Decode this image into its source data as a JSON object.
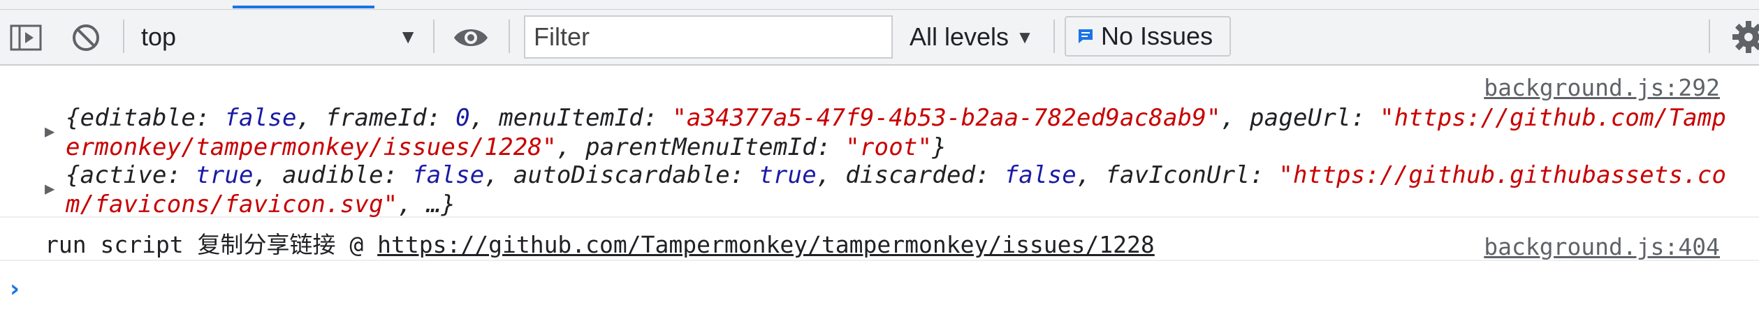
{
  "toolbar": {
    "context": "top",
    "filter_placeholder": "Filter",
    "levels": "All levels",
    "issues": "No Issues"
  },
  "console": {
    "messages": [
      {
        "source": "background.js:292",
        "parts": [
          {
            "t": "p",
            "v": "{"
          },
          {
            "t": "k",
            "v": "editable"
          },
          {
            "t": "p",
            "v": ": "
          },
          {
            "t": "kw",
            "v": "false"
          },
          {
            "t": "p",
            "v": ", "
          },
          {
            "t": "k",
            "v": "frameId"
          },
          {
            "t": "p",
            "v": ": "
          },
          {
            "t": "num",
            "v": "0"
          },
          {
            "t": "p",
            "v": ", "
          },
          {
            "t": "k",
            "v": "menuItemId"
          },
          {
            "t": "p",
            "v": ": "
          },
          {
            "t": "str",
            "v": "\"a34377a5-47f9-4b53-b2aa-782ed9ac8ab9\""
          },
          {
            "t": "p",
            "v": ", "
          },
          {
            "t": "k",
            "v": "pageUrl"
          },
          {
            "t": "p",
            "v": ": "
          },
          {
            "t": "str",
            "v": "\"https://github.com/Tampermonkey/tampermonkey/issues/1228\""
          },
          {
            "t": "p",
            "v": ", "
          },
          {
            "t": "k",
            "v": "parentMenuItemId"
          },
          {
            "t": "p",
            "v": ": "
          },
          {
            "t": "str",
            "v": "\"root\""
          },
          {
            "t": "p",
            "v": "}"
          }
        ]
      },
      {
        "source": "",
        "parts": [
          {
            "t": "p",
            "v": "{"
          },
          {
            "t": "k",
            "v": "active"
          },
          {
            "t": "p",
            "v": ": "
          },
          {
            "t": "kw",
            "v": "true"
          },
          {
            "t": "p",
            "v": ", "
          },
          {
            "t": "k",
            "v": "audible"
          },
          {
            "t": "p",
            "v": ": "
          },
          {
            "t": "kw",
            "v": "false"
          },
          {
            "t": "p",
            "v": ", "
          },
          {
            "t": "k",
            "v": "autoDiscardable"
          },
          {
            "t": "p",
            "v": ": "
          },
          {
            "t": "kw",
            "v": "true"
          },
          {
            "t": "p",
            "v": ", "
          },
          {
            "t": "k",
            "v": "discarded"
          },
          {
            "t": "p",
            "v": ": "
          },
          {
            "t": "kw",
            "v": "false"
          },
          {
            "t": "p",
            "v": ", "
          },
          {
            "t": "k",
            "v": "favIconUrl"
          },
          {
            "t": "p",
            "v": ": "
          },
          {
            "t": "str",
            "v": "\"https://github.githubassets.com/favicons/favicon.svg\""
          },
          {
            "t": "p",
            "v": ", …}"
          }
        ]
      }
    ],
    "log": {
      "text": "run script 复制分享链接 @ ",
      "url": "https://github.com/Tampermonkey/tampermonkey/issues/1228",
      "source": "background.js:404"
    },
    "prompt": "›"
  }
}
